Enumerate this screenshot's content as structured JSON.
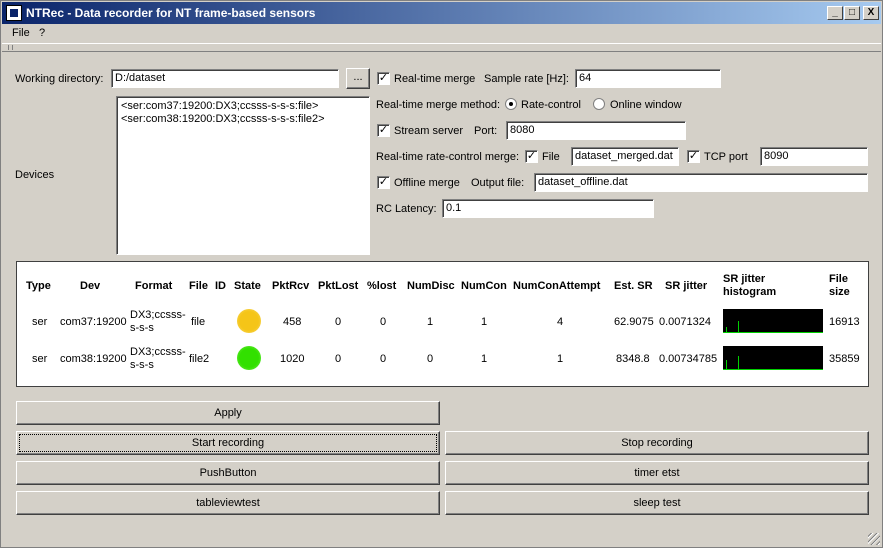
{
  "window": {
    "title": "NTRec - Data recorder for NT frame-based sensors",
    "minimize": "_",
    "maximize": "□",
    "close": "X"
  },
  "menu": [
    "File",
    "?"
  ],
  "settings": {
    "working_dir_label": "Working directory:",
    "working_dir_value": "D:/dataset",
    "browse_label": "...",
    "devices_label": "Devices",
    "devices": [
      "<ser:com37:19200:DX3;ccsss-s-s-s:file>",
      "<ser:com38:19200:DX3;ccsss-s-s-s:file2>"
    ],
    "realtime_merge_label": "Real-time merge",
    "realtime_merge_checked": true,
    "sample_rate_label": "Sample rate [Hz]:",
    "sample_rate_value": "64",
    "merge_method_label": "Real-time merge method:",
    "merge_method_options": [
      "Rate-control",
      "Online window"
    ],
    "merge_method_selected": "Rate-control",
    "stream_server_label": "Stream server",
    "stream_server_checked": true,
    "port_label": "Port:",
    "port_value": "8080",
    "rc_merge_label": "Real-time rate-control merge:",
    "rc_file_label": "File",
    "rc_file_checked": true,
    "rc_file_value": "dataset_merged.dat",
    "rc_tcp_label": "TCP port",
    "rc_tcp_checked": true,
    "rc_tcp_value": "8090",
    "offline_merge_label": "Offline merge",
    "offline_merge_checked": true,
    "output_file_label": "Output file:",
    "output_file_value": "dataset_offline.dat",
    "rc_latency_label": "RC Latency:",
    "rc_latency_value": "0.1"
  },
  "table": {
    "headers": [
      "Type",
      "Dev",
      "Format",
      "File",
      "ID",
      "State",
      "PktRcv",
      "PktLost",
      "%lost",
      "NumDisc",
      "NumCon",
      "NumConAttempt",
      "Est. SR",
      "SR jitter",
      "SR jitter histogram",
      "File size"
    ],
    "rows": [
      {
        "type": "ser",
        "dev": "com37:19200",
        "format": "DX3;ccsss-s-s-s",
        "file": "file",
        "id": "",
        "state_color": "#f5c518",
        "pktrcv": "458",
        "pktlost": "0",
        "lost": "0",
        "numdisc": "1",
        "numcon": "1",
        "numconattempt": "4",
        "est_sr": "62.9075",
        "sr_jitter": "0.0071324",
        "file_size": "16913"
      },
      {
        "type": "ser",
        "dev": "com38:19200",
        "format": "DX3;ccsss-s-s-s",
        "file": "file2",
        "id": "",
        "state_color": "#32e000",
        "pktrcv": "1020",
        "pktlost": "0",
        "lost": "0",
        "numdisc": "0",
        "numcon": "1",
        "numconattempt": "1",
        "est_sr": "8348.8",
        "sr_jitter": "0.00734785",
        "file_size": "35859"
      }
    ]
  },
  "buttons": {
    "apply": "Apply",
    "start_recording": "Start recording",
    "stop_recording": "Stop recording",
    "push_button": "PushButton",
    "timer_test": "timer etst",
    "tableviewtest": "tableviewtest",
    "sleep_test": "sleep test"
  }
}
